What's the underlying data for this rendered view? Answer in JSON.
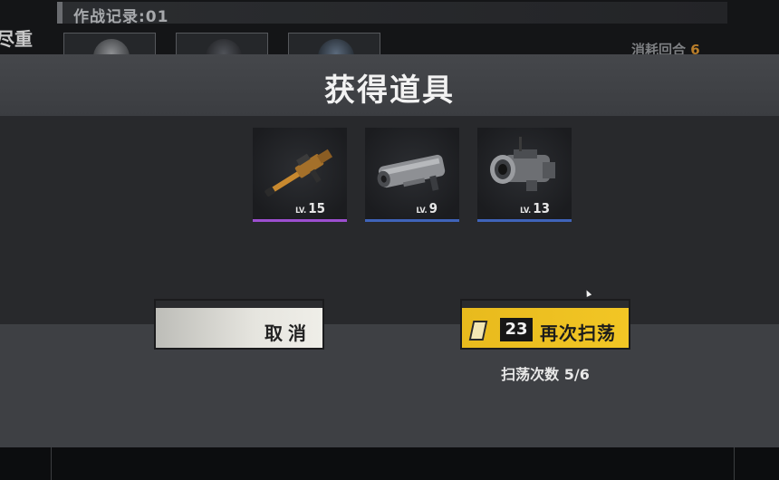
{
  "background": {
    "record_label": "作战记录:01",
    "left_text": "尽重",
    "rounds_label": "消耗回合",
    "rounds_value": "6"
  },
  "modal": {
    "title": "获得道具",
    "items": [
      {
        "name": "golden-rifle-icon",
        "lv_prefix": "LV.",
        "level": "15",
        "rarity_color": "#9d4fd0"
      },
      {
        "name": "heavy-gun-icon",
        "lv_prefix": "LV.",
        "level": "9",
        "rarity_color": "#3f63b9"
      },
      {
        "name": "cannon-icon",
        "lv_prefix": "LV.",
        "level": "13",
        "rarity_color": "#3f63b9"
      }
    ],
    "cancel_button": {
      "label": "取消"
    },
    "sweep_button": {
      "ticket_count": "23",
      "label": "再次扫荡"
    },
    "sweep_count_text": "扫荡次数 5/6"
  },
  "colors": {
    "accent_yellow": "#f2c625",
    "rarity_purple": "#9d4fd0",
    "rarity_blue": "#3f63b9"
  }
}
